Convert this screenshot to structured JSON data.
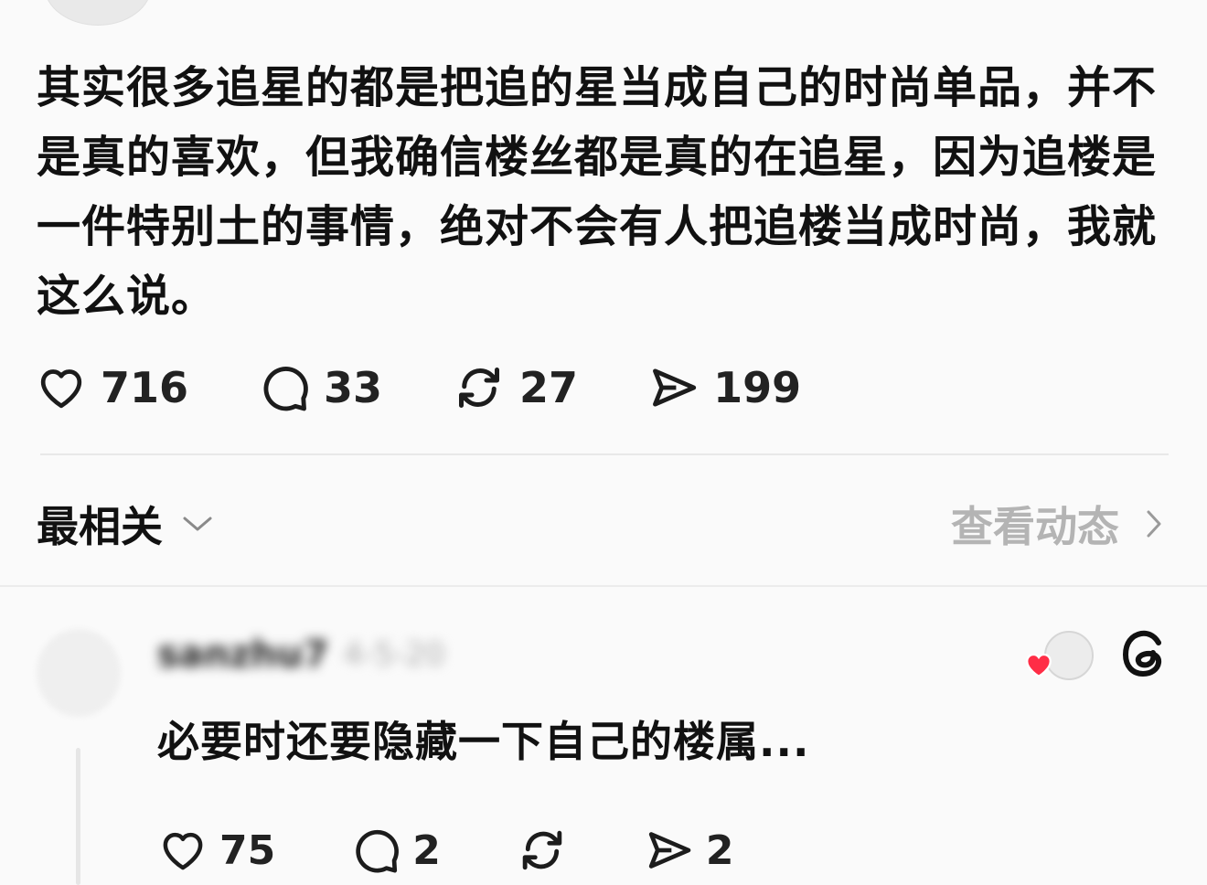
{
  "post": {
    "text": "其实很多追星的都是把追的星当成自己的时尚单品，并不是真的喜欢，但我确信楼丝都是真的在追星，因为追楼是一件特别土的事情，绝对不会有人把追楼当成时尚，我就这么说。",
    "likes": "716",
    "comments": "33",
    "reposts": "27",
    "shares": "199"
  },
  "replies_header": {
    "sort_label": "最相关",
    "view_activity_label": "查看动态"
  },
  "reply": {
    "username": "sanzhu7",
    "time": "4-5-20",
    "text": "必要时还要隐藏一下自己的楼属...",
    "likes": "75",
    "comments": "2",
    "shares": "2"
  },
  "colors": {
    "background": "#fafafa",
    "heart": "#ff2d46",
    "muted_text": "#b4b4b4"
  },
  "icons": [
    "heart-icon",
    "comment-icon",
    "repost-icon",
    "share-icon",
    "chevron-down-icon",
    "chevron-right-icon",
    "threads-logo-icon"
  ]
}
